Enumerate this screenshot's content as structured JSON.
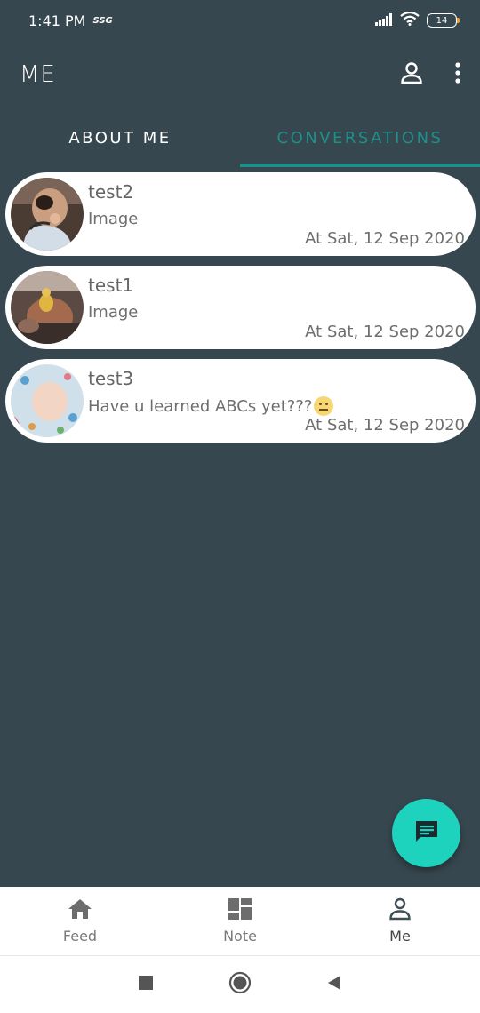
{
  "status_bar": {
    "time": "1:41 PM",
    "network_tag": "SSG",
    "battery": "14"
  },
  "app_bar": {
    "title": "ME",
    "icons": [
      "profile-icon",
      "more-vert-icon"
    ]
  },
  "tabs": [
    {
      "label": "ABOUT ME",
      "active": false
    },
    {
      "label": "CONVERSATIONS",
      "active": true
    }
  ],
  "conversations": [
    {
      "name": "test2",
      "message": "Image",
      "date": "At Sat, 12 Sep 2020",
      "emoji": false
    },
    {
      "name": "test1",
      "message": "Image",
      "date": "At Sat, 12 Sep 2020",
      "emoji": false
    },
    {
      "name": "test3",
      "message": "Have u learned ABCs yet???",
      "date": "At Sat, 12 Sep 2020",
      "emoji": true
    }
  ],
  "fab": {
    "icon": "chat-icon"
  },
  "bottom_nav": [
    {
      "label": "Feed",
      "icon": "home-icon",
      "active": false
    },
    {
      "label": "Note",
      "icon": "dashboard-icon",
      "active": false
    },
    {
      "label": "Me",
      "icon": "person-icon",
      "active": true
    }
  ],
  "colors": {
    "background": "#37474f",
    "accent": "#1f8f8a",
    "fab": "#1dd3bd"
  }
}
